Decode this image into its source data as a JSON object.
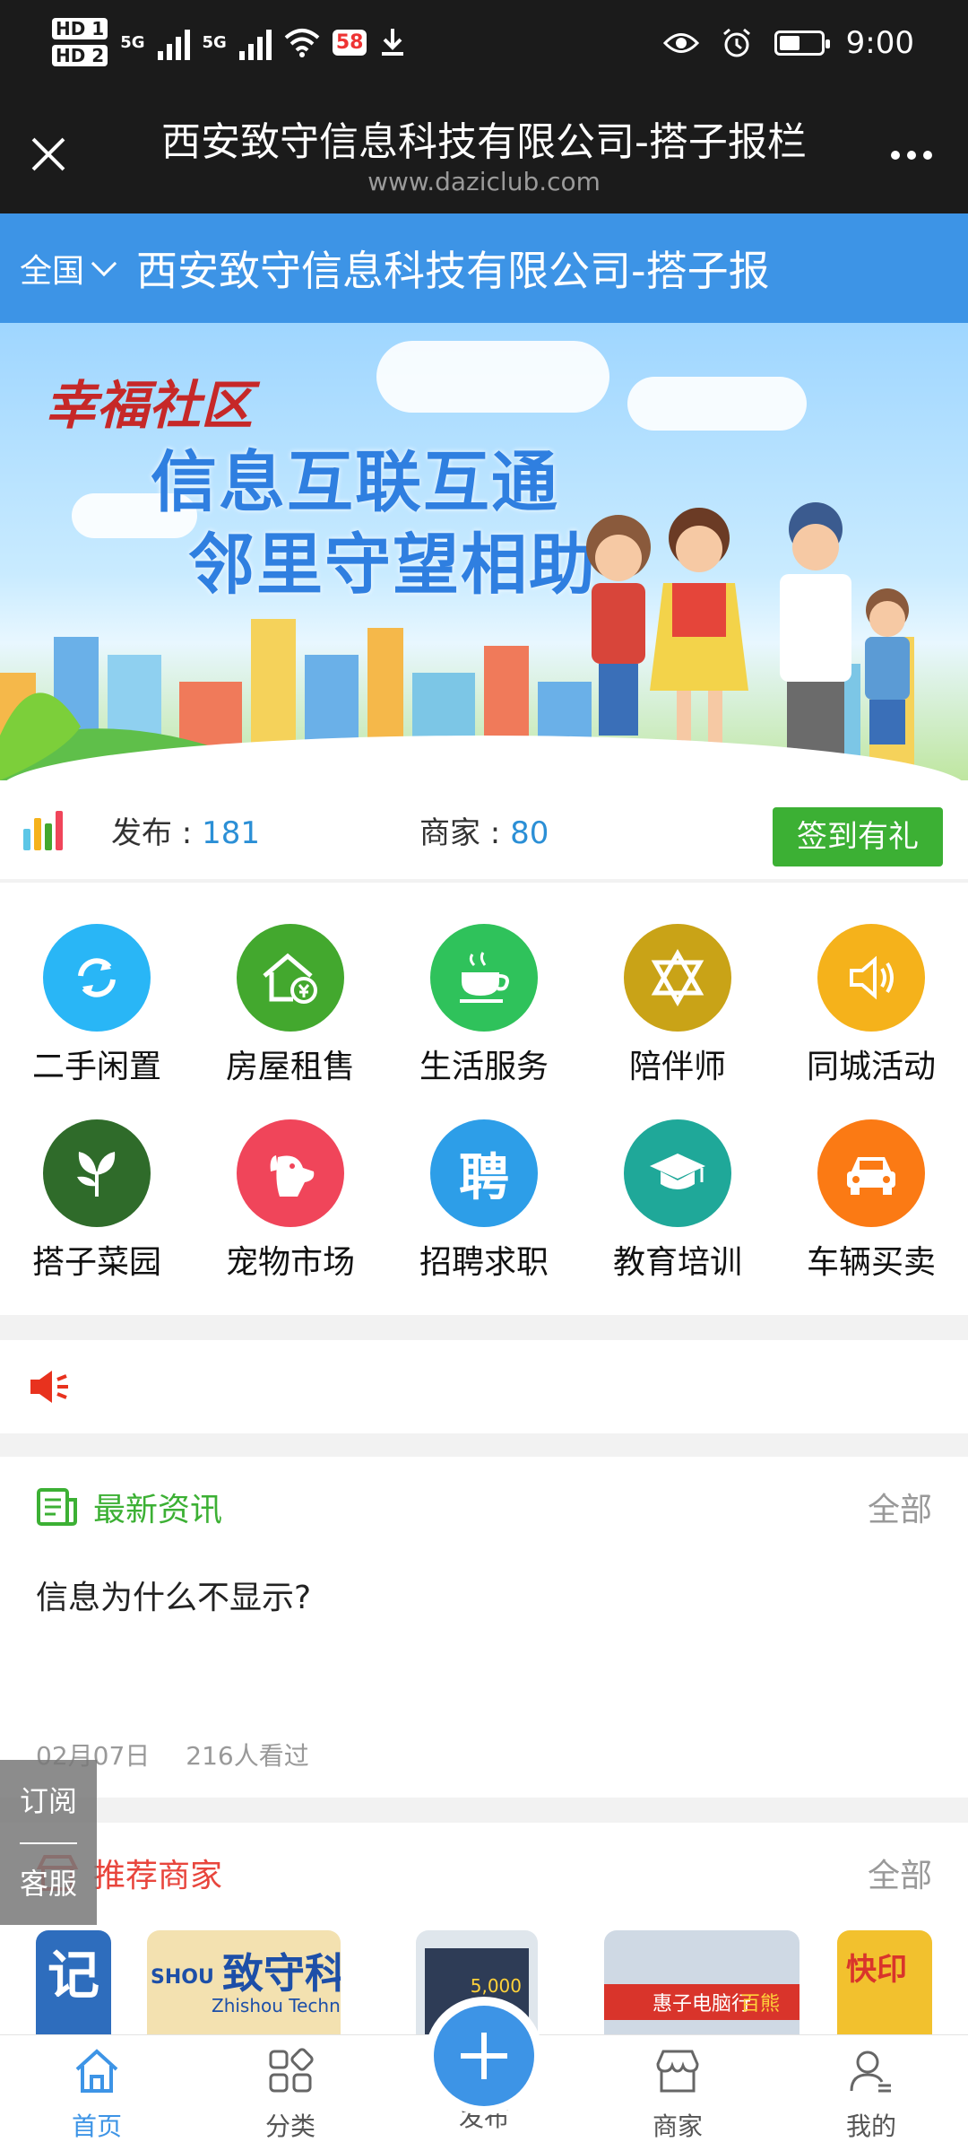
{
  "status_bar": {
    "hd1": "HD 1",
    "hd2": "HD 2",
    "net1": "5G",
    "net2": "5G",
    "app_badge": "58",
    "time": "9:00"
  },
  "browser": {
    "title": "西安致守信息科技有限公司-搭子报栏",
    "url": "www.daziclub.com"
  },
  "site": {
    "region": "全国",
    "title": "西安致守信息科技有限公司-搭子报"
  },
  "banner": {
    "brand": "幸福社区",
    "line1": "信息互联互通",
    "line2": "邻里守望相助"
  },
  "stats": {
    "publish_label": "发布",
    "publish_value": "181",
    "merchant_label": "商家",
    "merchant_value": "80",
    "checkin_label": "签到有礼"
  },
  "categories": [
    {
      "label": "二手闲置",
      "icon": "recycle-icon",
      "color": "#29b6f6"
    },
    {
      "label": "房屋租售",
      "icon": "house-icon",
      "color": "#43a82e"
    },
    {
      "label": "生活服务",
      "icon": "coffee-icon",
      "color": "#2fc25b"
    },
    {
      "label": "陪伴师",
      "icon": "knot-icon",
      "color": "#c9a317"
    },
    {
      "label": "同城活动",
      "icon": "speaker-icon",
      "color": "#f5b21b"
    },
    {
      "label": "搭子菜园",
      "icon": "vegetable-icon",
      "color": "#2f6b2a"
    },
    {
      "label": "宠物市场",
      "icon": "dog-icon",
      "color": "#f0455a"
    },
    {
      "label": "招聘求职",
      "icon": "hire-icon",
      "color": "#2d9ee8",
      "glyph": "聘"
    },
    {
      "label": "教育培训",
      "icon": "graduation-cap-icon",
      "color": "#1fa899"
    },
    {
      "label": "车辆买卖",
      "icon": "car-icon",
      "color": "#fb7a14"
    }
  ],
  "news": {
    "header": "最新资讯",
    "all": "全部",
    "item_title": "信息为什么不显示?",
    "item_date": "02月07日",
    "item_views": "216人看过"
  },
  "recommend": {
    "header": "推荐商家",
    "all": "全部",
    "shop2_text": "致守科",
    "shop2_sub": "Zhishou Techno",
    "shop2_brand": "SHOU",
    "shop1_text": "记账",
    "shop3_text": "5,000",
    "shop4_text": "惠子电脑行",
    "shop4_text2": "百熊",
    "shop5_text": "快印"
  },
  "side_float": {
    "subscribe": "订阅",
    "service": "客服"
  },
  "bottom_nav": {
    "home": "首页",
    "category": "分类",
    "publish": "发布",
    "merchant": "商家",
    "mine": "我的"
  },
  "colors": {
    "primary": "#3d94e6",
    "green": "#3cb034",
    "stat_number": "#2b8fd6",
    "news_header": "#3cb034",
    "recommend_header": "#e8453c"
  }
}
